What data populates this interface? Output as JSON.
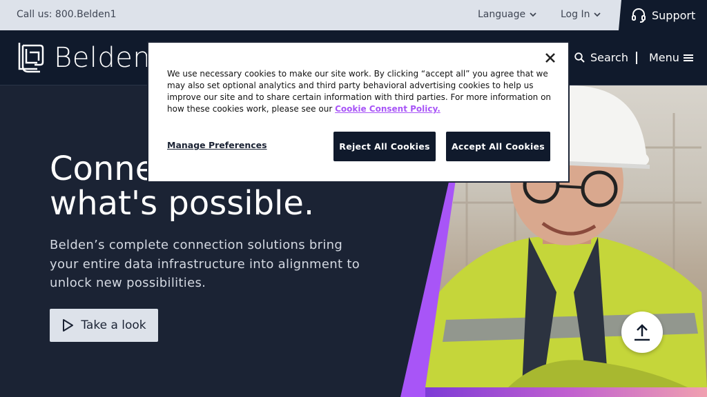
{
  "topbar": {
    "call": "Call us: 800.Belden1",
    "language": "Language",
    "login": "Log In",
    "support": "Support"
  },
  "header": {
    "logo_text": "Belden",
    "search": "Search",
    "menu": "Menu"
  },
  "hero": {
    "headline_line1": "Conne",
    "headline_line2": "what's possible.",
    "subtext": "Belden’s complete connection solutions bring your entire data infrastructure into alignment to unlock new possibilities.",
    "cta": "Take a look"
  },
  "cookie": {
    "text": "We use necessary cookies to make our site work. By clicking “accept all” you agree that we may also set optional analytics and third party behavioral advertising cookies to help us improve our site and to share certain information with third parties. For more information on how these cookies work, please see our",
    "link": "Cookie Consent Policy.",
    "manage": "Manage Preferences",
    "reject": "Reject All Cookies",
    "accept": "Accept All Cookies"
  },
  "colors": {
    "navy": "#101a2c",
    "hero_bg": "#1b2334",
    "accent_purple": "#a855f7",
    "topbar_bg": "#dde2ea"
  }
}
